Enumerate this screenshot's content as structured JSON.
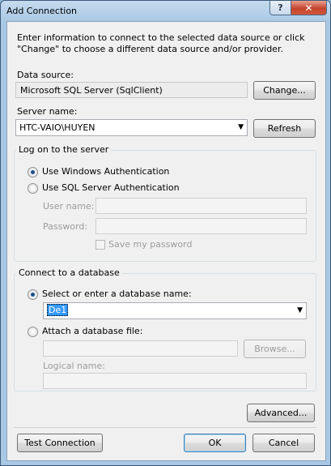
{
  "window": {
    "title": "Add Connection",
    "help_label": "?",
    "close_label": "✕"
  },
  "intro": "Enter information to connect to the selected data source or click \"Change\" to choose a different data source and/or provider.",
  "data_source": {
    "label": "Data source:",
    "value": "Microsoft SQL Server (SqlClient)",
    "change_button": "Change..."
  },
  "server": {
    "label": "Server name:",
    "value": "HTC-VAIO\\HUYEN",
    "refresh_button": "Refresh"
  },
  "logon": {
    "title": "Log on to the server",
    "windows_auth": "Use Windows Authentication",
    "windows_auth_selected": true,
    "sql_auth": "Use SQL Server Authentication",
    "sql_auth_selected": false,
    "user_name_label": "User name:",
    "user_name_value": "",
    "password_label": "Password:",
    "password_value": "",
    "save_password": "Save my password",
    "save_password_checked": false
  },
  "database": {
    "title": "Connect to a database",
    "select_option": "Select or enter a database name:",
    "select_option_selected": true,
    "database_name": "De1",
    "attach_option": "Attach a database file:",
    "attach_option_selected": false,
    "attach_file_value": "",
    "browse_button": "Browse...",
    "logical_name_label": "Logical name:",
    "logical_name_value": ""
  },
  "advanced_button": "Advanced...",
  "footer": {
    "test_connection": "Test Connection",
    "ok": "OK",
    "cancel": "Cancel"
  }
}
